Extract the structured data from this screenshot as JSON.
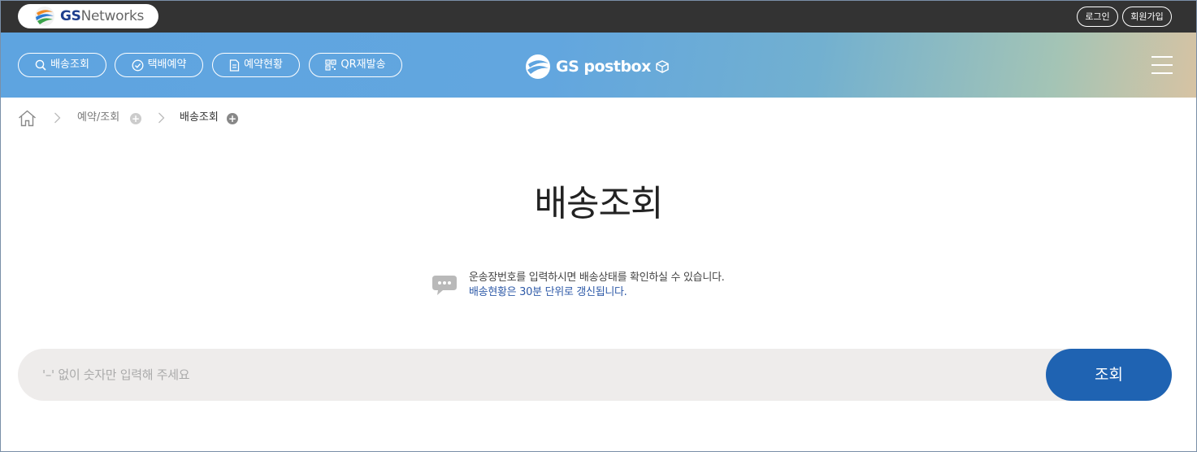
{
  "top_bar": {
    "logo": {
      "brand_bold": "GS",
      "brand_light": "Networks",
      "icon": "gs-networks-logo-icon"
    },
    "login_label": "로그인",
    "join_label": "회원가입"
  },
  "nav": {
    "pills": [
      {
        "label": "배송조회",
        "icon": "search-icon"
      },
      {
        "label": "택배예약",
        "icon": "clock-check-icon"
      },
      {
        "label": "예약현황",
        "icon": "document-icon"
      },
      {
        "label": "QR재발송",
        "icon": "qr-code-icon"
      }
    ],
    "center_logo": {
      "text": "GS postbox",
      "icon": "gs-postbox-logo-icon"
    },
    "menu_icon": "hamburger-menu-icon"
  },
  "breadcrumb": {
    "home_icon": "home-icon",
    "items": [
      "예약/조회",
      "배송조회"
    ]
  },
  "page": {
    "title": "배송조회",
    "notice_icon": "speech-bubble-icon",
    "notice_line1": "운송장번호를 입력하시면 배송상태를 확인하실 수 있습니다.",
    "notice_line2": "배송현황은 30분 단위로 갱신됩니다."
  },
  "search": {
    "placeholder": "'–' 없이 숫자만 입력해 주세요",
    "value": "",
    "button_label": "조회"
  },
  "colors": {
    "top_bar": "#333333",
    "header_gradient_start": "#5ea4e0",
    "header_gradient_end": "#d7c3a3",
    "search_button": "#1f63b2",
    "notice_highlight": "#2e5aa8",
    "search_field": "#eeeceb"
  }
}
